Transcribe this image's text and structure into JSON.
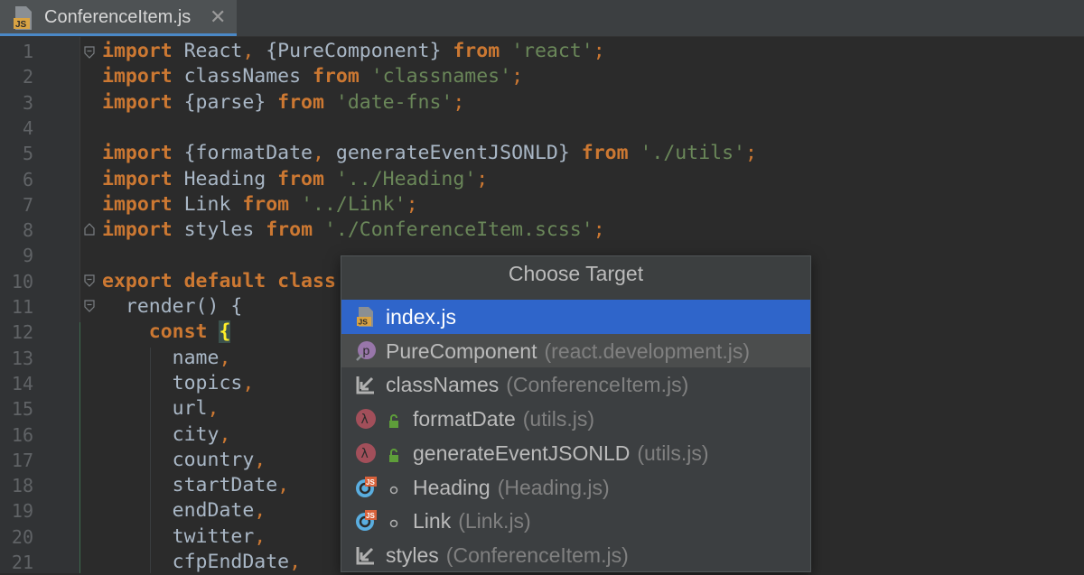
{
  "tab": {
    "label": "ConferenceItem.js",
    "icon": "js-file-icon",
    "close": "✕"
  },
  "code": {
    "line_numbers": [
      "1",
      "2",
      "3",
      "4",
      "5",
      "6",
      "7",
      "8",
      "9",
      "10",
      "11",
      "12",
      "13",
      "14",
      "15",
      "16",
      "17",
      "18",
      "19",
      "20",
      "21"
    ],
    "lines": [
      [
        [
          "kw",
          "import"
        ],
        [
          "id",
          " React"
        ],
        [
          "punc",
          ","
        ],
        [
          "id",
          " {PureComponent} "
        ],
        [
          "kw",
          "from"
        ],
        [
          "str",
          " 'react'"
        ],
        [
          "punc",
          ";"
        ]
      ],
      [
        [
          "kw",
          "import"
        ],
        [
          "id",
          " classNames "
        ],
        [
          "kw",
          "from"
        ],
        [
          "str",
          " 'classnames'"
        ],
        [
          "punc",
          ";"
        ]
      ],
      [
        [
          "kw",
          "import"
        ],
        [
          "id",
          " {parse} "
        ],
        [
          "kw",
          "from"
        ],
        [
          "str",
          " 'date-fns'"
        ],
        [
          "punc",
          ";"
        ]
      ],
      [],
      [
        [
          "kw",
          "import"
        ],
        [
          "id",
          " {formatDate"
        ],
        [
          "punc",
          ","
        ],
        [
          "id",
          " generateEventJSONLD} "
        ],
        [
          "kw",
          "from"
        ],
        [
          "str",
          " './utils'"
        ],
        [
          "punc",
          ";"
        ]
      ],
      [
        [
          "kw",
          "import"
        ],
        [
          "id",
          " Heading "
        ],
        [
          "kw",
          "from"
        ],
        [
          "str",
          " '../Heading'"
        ],
        [
          "punc",
          ";"
        ]
      ],
      [
        [
          "kw",
          "import"
        ],
        [
          "id",
          " Link "
        ],
        [
          "kw",
          "from"
        ],
        [
          "str",
          " '../Link'"
        ],
        [
          "punc",
          ";"
        ]
      ],
      [
        [
          "kw",
          "import"
        ],
        [
          "id",
          " styles "
        ],
        [
          "kw",
          "from"
        ],
        [
          "str",
          " './ConferenceItem.scss'"
        ],
        [
          "punc",
          ";"
        ]
      ],
      [],
      [
        [
          "kw",
          "export default class"
        ]
      ],
      [
        [
          "id",
          "  render() {"
        ]
      ],
      [
        [
          "id",
          "    "
        ],
        [
          "kw",
          "const"
        ],
        [
          "id",
          " "
        ],
        [
          "hl",
          "{"
        ]
      ],
      [
        [
          "id",
          "      name"
        ],
        [
          "punc",
          ","
        ]
      ],
      [
        [
          "id",
          "      topics"
        ],
        [
          "punc",
          ","
        ]
      ],
      [
        [
          "id",
          "      url"
        ],
        [
          "punc",
          ","
        ]
      ],
      [
        [
          "id",
          "      city"
        ],
        [
          "punc",
          ","
        ]
      ],
      [
        [
          "id",
          "      country"
        ],
        [
          "punc",
          ","
        ]
      ],
      [
        [
          "id",
          "      startDate"
        ],
        [
          "punc",
          ","
        ]
      ],
      [
        [
          "id",
          "      endDate"
        ],
        [
          "punc",
          ","
        ]
      ],
      [
        [
          "id",
          "      twitter"
        ],
        [
          "punc",
          ","
        ]
      ],
      [
        [
          "id",
          "      cfpEndDate"
        ],
        [
          "punc",
          ","
        ]
      ]
    ]
  },
  "popup": {
    "title": "Choose Target",
    "items": [
      {
        "icon": "js-file-icon",
        "name": "index.js",
        "location": "",
        "selected": true
      },
      {
        "icon": "property-icon",
        "name": "PureComponent",
        "location": "(react.development.js)",
        "hovered": true
      },
      {
        "icon": "variable-icon",
        "name": "classNames",
        "location": "(ConferenceItem.js)"
      },
      {
        "icon": "lambda-function-icon",
        "visibility": "lock-icon",
        "name": "formatDate",
        "location": "(utils.js)"
      },
      {
        "icon": "lambda-function-icon",
        "visibility": "lock-icon",
        "name": "generateEventJSONLD",
        "location": "(utils.js)"
      },
      {
        "icon": "js-class-icon",
        "visibility": "dot-icon",
        "name": "Heading",
        "location": "(Heading.js)"
      },
      {
        "icon": "js-class-icon",
        "visibility": "dot-icon",
        "name": "Link",
        "location": "(Link.js)"
      },
      {
        "icon": "variable-icon",
        "name": "styles",
        "location": "(ConferenceItem.js)"
      }
    ]
  },
  "colors": {
    "keyword": "#cc7832",
    "string": "#6a8759",
    "text": "#a9b7c6",
    "selection": "#2f65ca",
    "background": "#2b2b2b"
  }
}
